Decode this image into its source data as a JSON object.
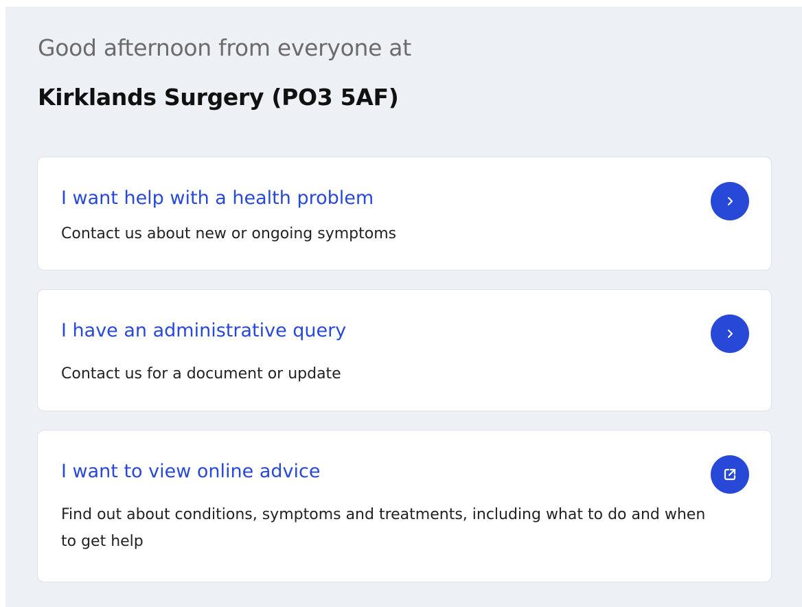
{
  "header": {
    "greeting": "Good afternoon from everyone at",
    "surgery_name": "Kirklands Surgery (PO3 5AF)"
  },
  "options": [
    {
      "title": "I want help with a health problem",
      "description": "Contact us about new or ongoing symptoms",
      "icon": "chevron-right-icon"
    },
    {
      "title": "I have an administrative query",
      "description": "Contact us for a document or update",
      "icon": "chevron-right-icon"
    },
    {
      "title": "I want to view online advice",
      "description": "Find out about conditions, symptoms and treatments, including what to do and when to get help",
      "icon": "external-link-icon"
    }
  ],
  "colors": {
    "accent": "#2849d8",
    "background": "#edf0f5",
    "card": "#ffffff",
    "greeting_text": "#6b6b6b",
    "heading_text": "#111111"
  }
}
